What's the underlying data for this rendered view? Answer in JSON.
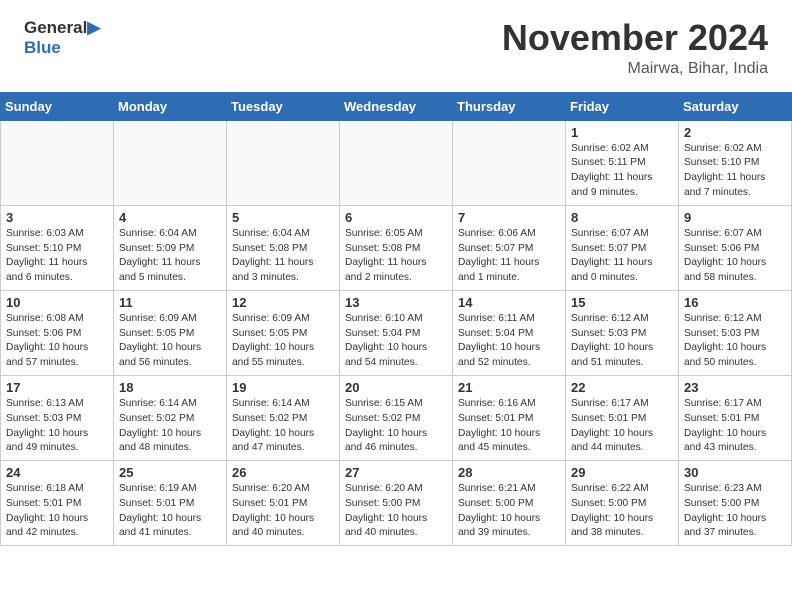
{
  "header": {
    "logo_line1": "General",
    "logo_line2": "Blue",
    "month": "November 2024",
    "location": "Mairwa, Bihar, India"
  },
  "days_of_week": [
    "Sunday",
    "Monday",
    "Tuesday",
    "Wednesday",
    "Thursday",
    "Friday",
    "Saturday"
  ],
  "weeks": [
    [
      {
        "day": "",
        "info": ""
      },
      {
        "day": "",
        "info": ""
      },
      {
        "day": "",
        "info": ""
      },
      {
        "day": "",
        "info": ""
      },
      {
        "day": "",
        "info": ""
      },
      {
        "day": "1",
        "info": "Sunrise: 6:02 AM\nSunset: 5:11 PM\nDaylight: 11 hours\nand 9 minutes."
      },
      {
        "day": "2",
        "info": "Sunrise: 6:02 AM\nSunset: 5:10 PM\nDaylight: 11 hours\nand 7 minutes."
      }
    ],
    [
      {
        "day": "3",
        "info": "Sunrise: 6:03 AM\nSunset: 5:10 PM\nDaylight: 11 hours\nand 6 minutes."
      },
      {
        "day": "4",
        "info": "Sunrise: 6:04 AM\nSunset: 5:09 PM\nDaylight: 11 hours\nand 5 minutes."
      },
      {
        "day": "5",
        "info": "Sunrise: 6:04 AM\nSunset: 5:08 PM\nDaylight: 11 hours\nand 3 minutes."
      },
      {
        "day": "6",
        "info": "Sunrise: 6:05 AM\nSunset: 5:08 PM\nDaylight: 11 hours\nand 2 minutes."
      },
      {
        "day": "7",
        "info": "Sunrise: 6:06 AM\nSunset: 5:07 PM\nDaylight: 11 hours\nand 1 minute."
      },
      {
        "day": "8",
        "info": "Sunrise: 6:07 AM\nSunset: 5:07 PM\nDaylight: 11 hours\nand 0 minutes."
      },
      {
        "day": "9",
        "info": "Sunrise: 6:07 AM\nSunset: 5:06 PM\nDaylight: 10 hours\nand 58 minutes."
      }
    ],
    [
      {
        "day": "10",
        "info": "Sunrise: 6:08 AM\nSunset: 5:06 PM\nDaylight: 10 hours\nand 57 minutes."
      },
      {
        "day": "11",
        "info": "Sunrise: 6:09 AM\nSunset: 5:05 PM\nDaylight: 10 hours\nand 56 minutes."
      },
      {
        "day": "12",
        "info": "Sunrise: 6:09 AM\nSunset: 5:05 PM\nDaylight: 10 hours\nand 55 minutes."
      },
      {
        "day": "13",
        "info": "Sunrise: 6:10 AM\nSunset: 5:04 PM\nDaylight: 10 hours\nand 54 minutes."
      },
      {
        "day": "14",
        "info": "Sunrise: 6:11 AM\nSunset: 5:04 PM\nDaylight: 10 hours\nand 52 minutes."
      },
      {
        "day": "15",
        "info": "Sunrise: 6:12 AM\nSunset: 5:03 PM\nDaylight: 10 hours\nand 51 minutes."
      },
      {
        "day": "16",
        "info": "Sunrise: 6:12 AM\nSunset: 5:03 PM\nDaylight: 10 hours\nand 50 minutes."
      }
    ],
    [
      {
        "day": "17",
        "info": "Sunrise: 6:13 AM\nSunset: 5:03 PM\nDaylight: 10 hours\nand 49 minutes."
      },
      {
        "day": "18",
        "info": "Sunrise: 6:14 AM\nSunset: 5:02 PM\nDaylight: 10 hours\nand 48 minutes."
      },
      {
        "day": "19",
        "info": "Sunrise: 6:14 AM\nSunset: 5:02 PM\nDaylight: 10 hours\nand 47 minutes."
      },
      {
        "day": "20",
        "info": "Sunrise: 6:15 AM\nSunset: 5:02 PM\nDaylight: 10 hours\nand 46 minutes."
      },
      {
        "day": "21",
        "info": "Sunrise: 6:16 AM\nSunset: 5:01 PM\nDaylight: 10 hours\nand 45 minutes."
      },
      {
        "day": "22",
        "info": "Sunrise: 6:17 AM\nSunset: 5:01 PM\nDaylight: 10 hours\nand 44 minutes."
      },
      {
        "day": "23",
        "info": "Sunrise: 6:17 AM\nSunset: 5:01 PM\nDaylight: 10 hours\nand 43 minutes."
      }
    ],
    [
      {
        "day": "24",
        "info": "Sunrise: 6:18 AM\nSunset: 5:01 PM\nDaylight: 10 hours\nand 42 minutes."
      },
      {
        "day": "25",
        "info": "Sunrise: 6:19 AM\nSunset: 5:01 PM\nDaylight: 10 hours\nand 41 minutes."
      },
      {
        "day": "26",
        "info": "Sunrise: 6:20 AM\nSunset: 5:01 PM\nDaylight: 10 hours\nand 40 minutes."
      },
      {
        "day": "27",
        "info": "Sunrise: 6:20 AM\nSunset: 5:00 PM\nDaylight: 10 hours\nand 40 minutes."
      },
      {
        "day": "28",
        "info": "Sunrise: 6:21 AM\nSunset: 5:00 PM\nDaylight: 10 hours\nand 39 minutes."
      },
      {
        "day": "29",
        "info": "Sunrise: 6:22 AM\nSunset: 5:00 PM\nDaylight: 10 hours\nand 38 minutes."
      },
      {
        "day": "30",
        "info": "Sunrise: 6:23 AM\nSunset: 5:00 PM\nDaylight: 10 hours\nand 37 minutes."
      }
    ]
  ]
}
